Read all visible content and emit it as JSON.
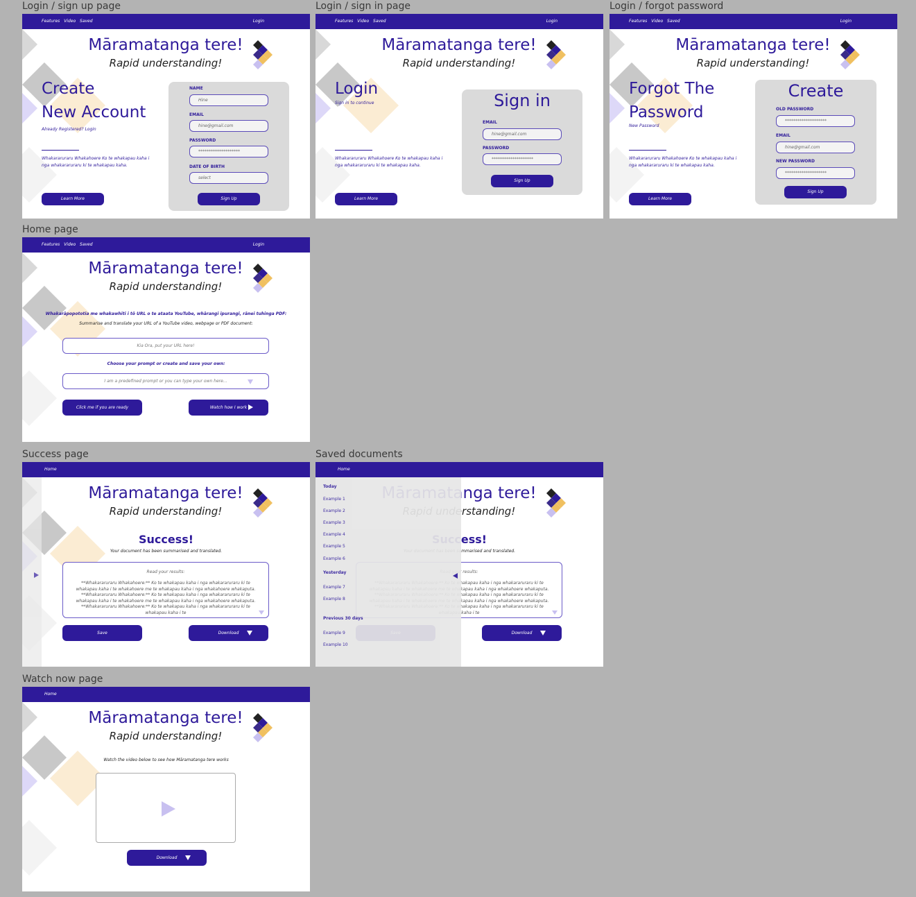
{
  "labels": {
    "signup": "Login / sign up page",
    "signin": "Login / sign in page",
    "forgot": "Login / forgot password",
    "home": "Home page",
    "success": "Success page",
    "saved": "Saved documents",
    "watch": "Watch now page"
  },
  "nav": {
    "links": "Features  Video  Saved",
    "login": "Login",
    "home": "Home"
  },
  "brand": {
    "title": "Māramatanga tere!",
    "subtitle": "Rapid understanding!"
  },
  "common": {
    "paragraph": "Whakararuraru Whakahoere Ko te whakapau kaha i nga whakararuraru ki te whakapau kaha.",
    "learn_more": "Learn More"
  },
  "signup": {
    "heading_1": "Create",
    "heading_2": "New Account",
    "sublink": "Already Registered? Login",
    "name_label": "NAME",
    "name_value": "Hine",
    "email_label": "EMAIL",
    "email_value": "hine@gmail.com",
    "password_label": "PASSWORD",
    "password_value": "********************",
    "dob_label": "DATE OF BIRTH",
    "dob_value": "select",
    "submit": "Sign Up"
  },
  "signin": {
    "heading": "Login",
    "sublink": "Sign in to continue",
    "card_title": "Sign in",
    "email_label": "EMAIL",
    "email_value": "hine@gmail.com",
    "password_label": "PASSWORD",
    "password_value": "********************",
    "submit": "Sign Up"
  },
  "forgot": {
    "heading_1": "Forgot The",
    "heading_2": "Password",
    "sublink": "New Password",
    "card_title": "Create",
    "old_label": "OLD PASSWORD",
    "old_value": "********************",
    "email_label": "EMAIL",
    "email_value": "hine@gmail.com",
    "new_label": "NEW PASSWORD",
    "new_value": "********************",
    "submit": "Sign Up"
  },
  "home": {
    "maori_prompt": "Whakarāpopototia me whakawhiti i tō URL o te ataata YouTube, whārangi ipurangi, rānei tuhinga PDF:",
    "english_prompt": "Summarise and translate your URL of a YouTube video, webpage or PDF document:",
    "url_placeholder": "Kia Ora, put your URL here!",
    "choose_prompt": "Choose your prompt or create and save your own:",
    "prompt_placeholder": "I am a predefined prompt or you can type your own here...",
    "ready_button": "Click me if you are ready",
    "watch_button": "Watch how I work"
  },
  "success": {
    "heading": "Success!",
    "message": "Your document has been summarised and translated.",
    "results_heading": "Read your results:",
    "results_text": "**Whakararuraru Whakahoere:** Ko te whakapau kaha i nga whakararuraru ki te whakapau kaha i te whakahoere me te whakapau kaha i nga whakahoere whakaputa. **Whakararuraru Whakahoere:** Ko te whakapau kaha i nga whakararuraru ki te whakapau kaha i te whakahoere me te whakapau kaha i nga whakahoere whakaputa. **Whakararuraru Whakahoere:** Ko te whakapau kaha i nga whakararuraru ki te whakapau kaha i te",
    "save": "Save",
    "download": "Download"
  },
  "saved": {
    "today": "Today",
    "today_items": [
      "Example 1",
      "Example 2",
      "Example 3",
      "Example 4",
      "Example 5",
      "Example 6"
    ],
    "yesterday": "Yesterday",
    "yesterday_items": [
      "Example 7",
      "Example 8"
    ],
    "previous": "Previous 30 days",
    "previous_items": [
      "Example 9",
      "Example 10"
    ]
  },
  "watch": {
    "instruction": "Watch the video below to see how Māramatanga tere works",
    "download": "Download"
  },
  "colors": {
    "primary": "#2e1a9a",
    "accent": "#f0c060",
    "light": "#c8c0f0"
  },
  "icons": [
    "diamond-logo-icon",
    "dropdown-arrow-icon",
    "play-icon",
    "download-arrow-icon",
    "collapse-arrow-icon"
  ]
}
